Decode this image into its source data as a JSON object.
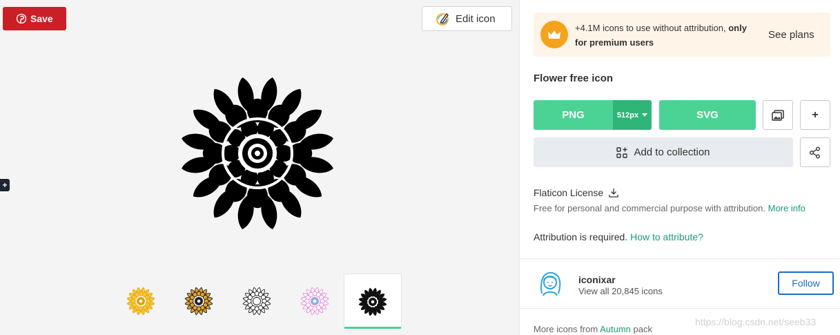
{
  "left": {
    "save_label": "Save",
    "edit_label": "Edit icon",
    "side_toggle": "+",
    "variants": [
      "sunflower-yellow-icon",
      "sunflower-orange-icon",
      "sunflower-outline-icon",
      "sunflower-pastel-icon",
      "sunflower-black-icon"
    ],
    "selected_variant": 4
  },
  "promo": {
    "text_pre": "+4.1M icons to use without attribution,",
    "text_bold_1": "only",
    "text_bold_2": "for premium users",
    "cta": "See plans"
  },
  "icon_title": "Flower free icon",
  "download": {
    "png_label": "PNG",
    "size_label": "512px",
    "svg_label": "SVG",
    "plus_label": "+",
    "collection_label": "Add to collection"
  },
  "license": {
    "title": "Flaticon License",
    "desc": "Free for personal and commercial purpose with attribution.",
    "more_info": "More info",
    "attribution": "Attribution is required.",
    "how_to": "How to attribute?"
  },
  "author": {
    "name": "iconixar",
    "sub": "View all 20,845 icons",
    "follow_label": "Follow"
  },
  "more": {
    "pre": "More icons from",
    "pack": "Autumn",
    "post": "pack"
  },
  "watermark": "https://blog.csdn.net/seeb33",
  "colors": {
    "pinterest_red": "#cb1f27",
    "accent_green": "#4ad395",
    "link_green": "#1a9b7b",
    "follow_blue": "#1b6ec2",
    "promo_bg": "#fff4e8",
    "crown_orange": "#f6a21c"
  }
}
